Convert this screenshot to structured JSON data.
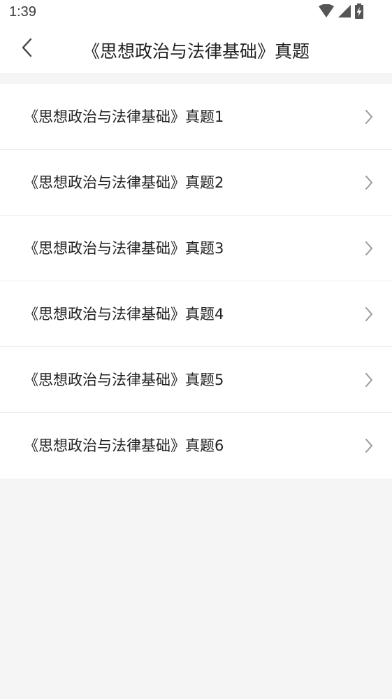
{
  "status_bar": {
    "time": "1:39",
    "icons": [
      "wifi-icon",
      "cell-signal-icon",
      "battery-charging-icon"
    ]
  },
  "header": {
    "back_icon": "chevron-left-icon",
    "title": "《思想政治与法律基础》真题"
  },
  "list": {
    "items": [
      {
        "label": "《思想政治与法律基础》真题1"
      },
      {
        "label": "《思想政治与法律基础》真题2"
      },
      {
        "label": "《思想政治与法律基础》真题3"
      },
      {
        "label": "《思想政治与法律基础》真题4"
      },
      {
        "label": "《思想政治与法律基础》真题5"
      },
      {
        "label": "《思想政治与法律基础》真题6"
      }
    ],
    "chevron_icon": "chevron-right-icon"
  }
}
